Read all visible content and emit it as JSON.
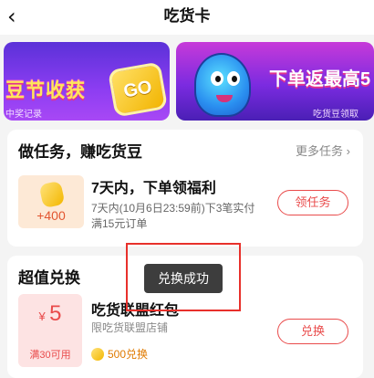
{
  "header": {
    "back_glyph": "‹",
    "title": "吃货卡"
  },
  "banners": {
    "left_title": "豆节收获",
    "left_sub": "中奖记录",
    "left_badge": "GO",
    "right_title": "下单返最高5",
    "right_sub": "吃货豆领取"
  },
  "tasks": {
    "title": "做任务，赚吃货豆",
    "more": "更多任务 ›",
    "item": {
      "reward": "+400",
      "name": "7天内，下单领福利",
      "desc": "7天内(10月6日23:59前)下3笔实付满15元订单",
      "button": "领任务"
    }
  },
  "deals": {
    "title": "超值兑换",
    "item": {
      "currency": "¥",
      "amount": "5",
      "condition": "满30可用",
      "name": "吃货联盟红包",
      "sub": "限吃货联盟店铺",
      "cost": "500兑换",
      "button": "兑换"
    }
  },
  "toast": "兑换成功",
  "colors": {
    "accent": "#e94b4b",
    "highlight_border": "#e8302b"
  }
}
